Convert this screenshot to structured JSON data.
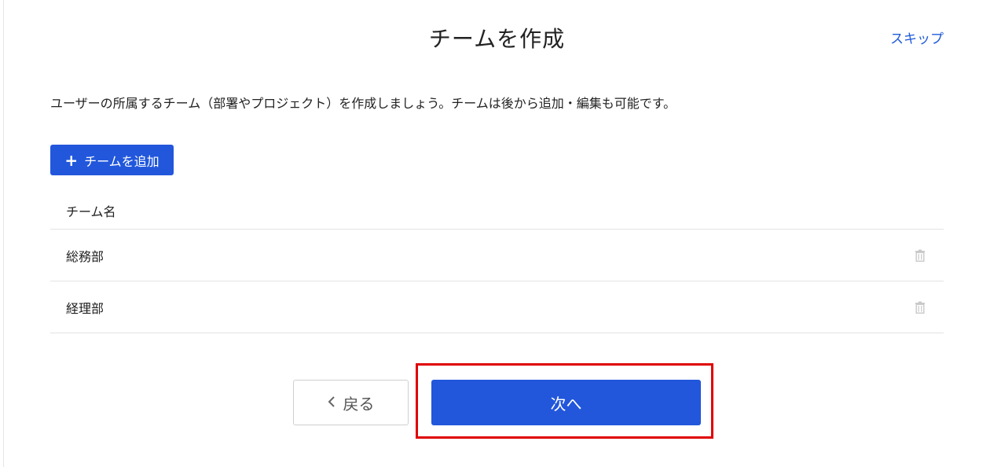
{
  "header": {
    "title": "チームを作成",
    "skip_label": "スキップ"
  },
  "description": "ユーザーの所属するチーム（部署やプロジェクト）を作成しましょう。チームは後から追加・編集も可能です。",
  "add_team_button": {
    "icon": "plus-icon",
    "label": "チームを追加"
  },
  "table": {
    "column_header": "チーム名",
    "rows": [
      {
        "name": "総務部",
        "action_icon": "trash-icon"
      },
      {
        "name": "経理部",
        "action_icon": "trash-icon"
      }
    ]
  },
  "footer": {
    "back_label": "戻る",
    "back_icon": "chevron-left-icon",
    "next_label": "次へ"
  },
  "colors": {
    "primary": "#2257dc",
    "link": "#1f5ad9",
    "highlight": "#e00000",
    "divider": "#e3e3e3"
  }
}
